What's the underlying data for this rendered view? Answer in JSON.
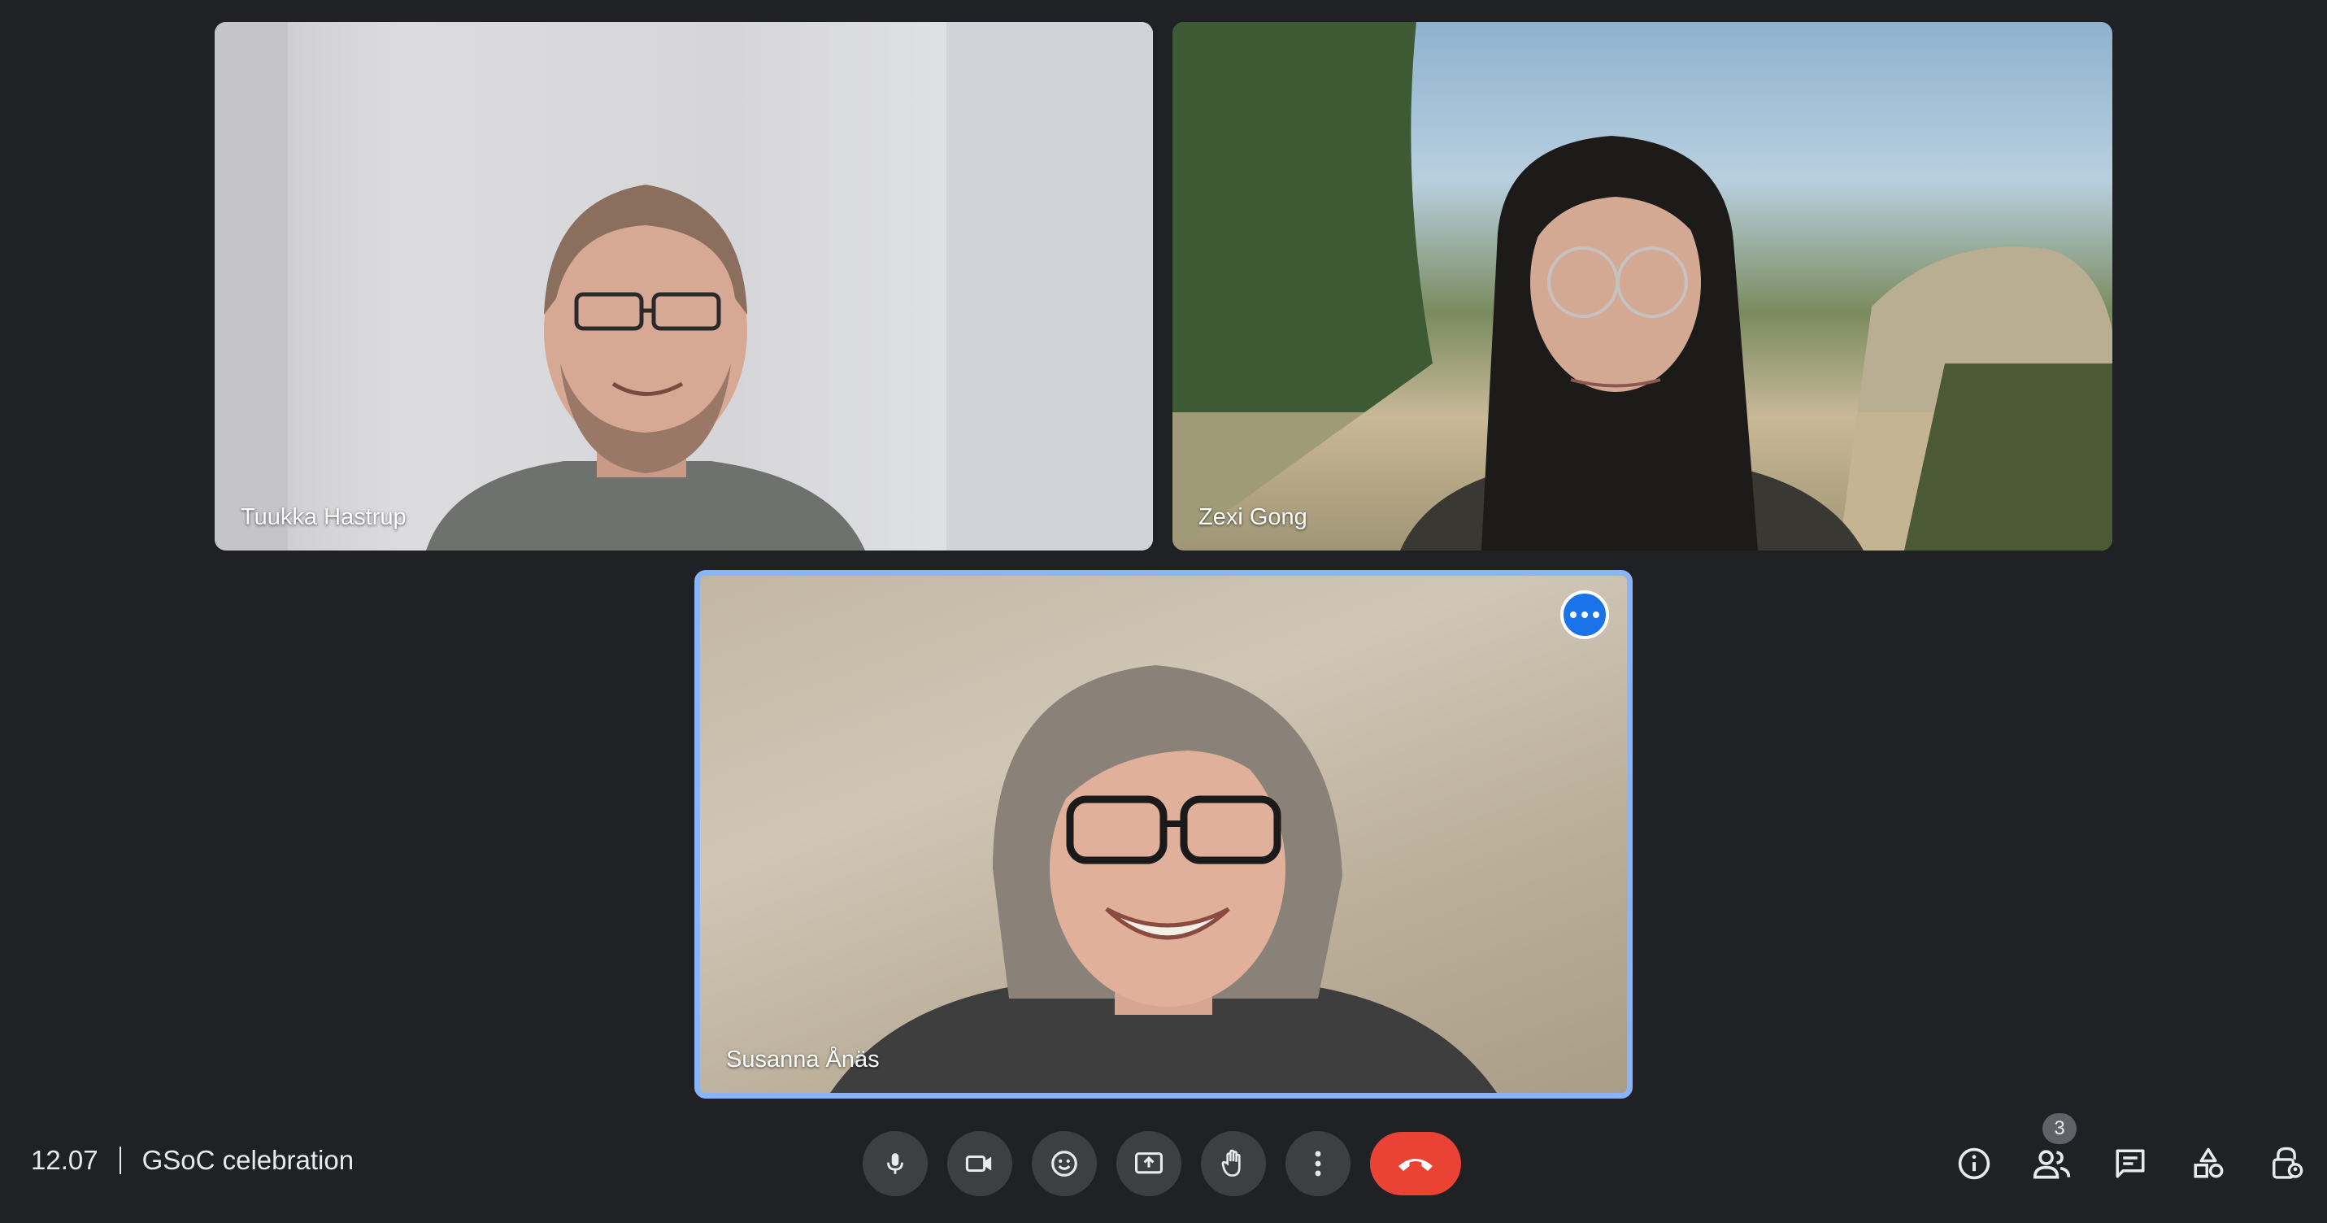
{
  "meeting": {
    "time": "12.07",
    "title": "GSoC celebration"
  },
  "participants": [
    {
      "name": "Tuukka Hastrup"
    },
    {
      "name": "Zexi Gong"
    },
    {
      "name": "Susanna Ånäs",
      "active_speaker": true
    }
  ],
  "people_count": "3",
  "controls": {
    "buttons": [
      "microphone",
      "camera",
      "emoji-reactions",
      "present-screen",
      "raise-hand",
      "more-options",
      "leave-call"
    ],
    "leave_color": "#ea4335"
  },
  "side_controls": [
    "meeting-details",
    "people",
    "chat",
    "activities",
    "host-controls"
  ],
  "colors": {
    "background": "#202124",
    "active_border": "#8ab4f8",
    "button_bg": "#3c4043"
  }
}
